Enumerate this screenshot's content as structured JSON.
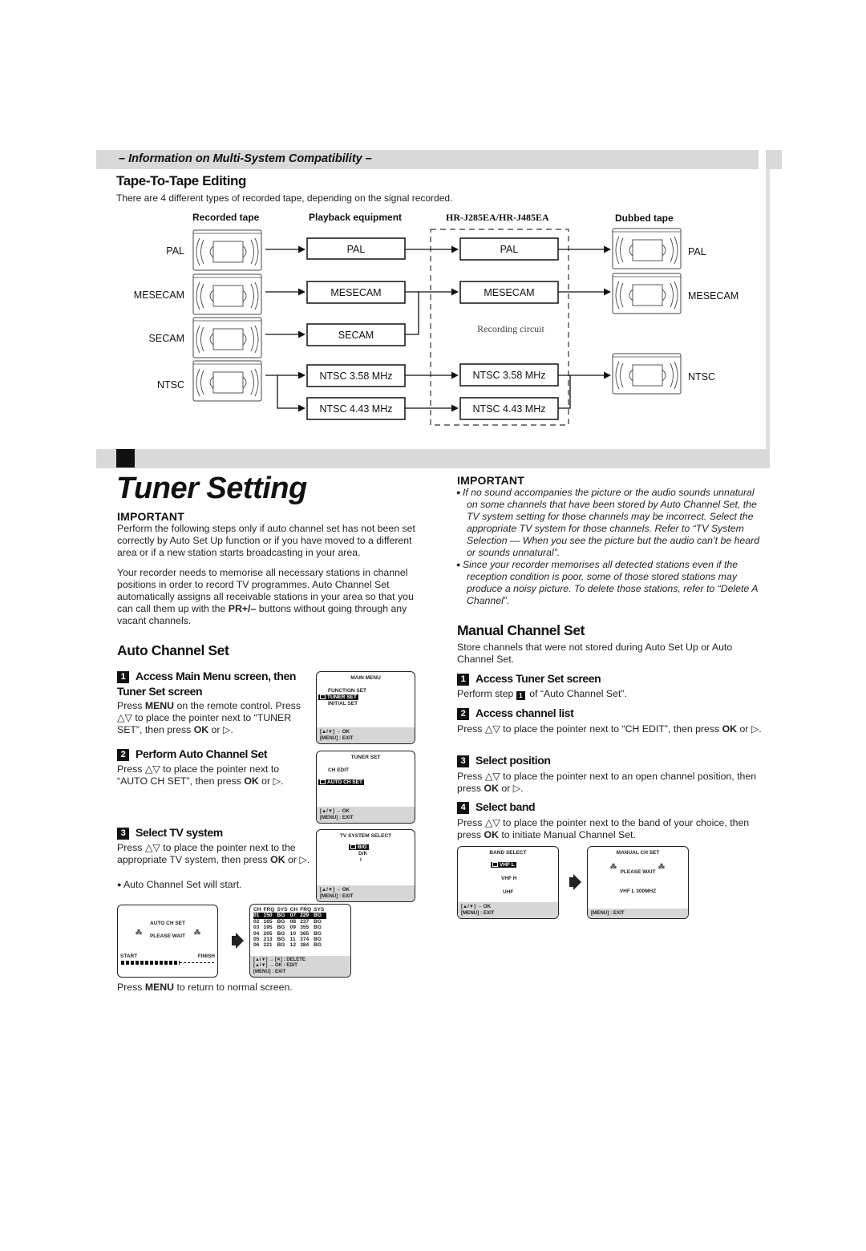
{
  "section_banner": "– Information on Multi-System Compatibility –",
  "tape_to_tape": {
    "heading": "Tape-To-Tape Editing",
    "intro": "There are 4 different types of recorded tape, depending on the signal recorded.",
    "columns": [
      "Recorded tape",
      "Playback equipment",
      "HR-J285EA/HR-J485EA",
      "Dubbed tape"
    ],
    "recorded_tapes": [
      "PAL",
      "MESECAM",
      "SECAM",
      "NTSC"
    ],
    "playback_boxes": [
      "PAL",
      "MESECAM",
      "SECAM",
      "NTSC 3.58 MHz",
      "NTSC 4.43 MHz"
    ],
    "recording_boxes": [
      "PAL",
      "MESECAM",
      "NTSC 3.58 MHz",
      "NTSC 4.43 MHz"
    ],
    "recording_circuit_label": "Recording circuit",
    "dubbed_tapes": [
      "PAL",
      "MESECAM",
      "NTSC"
    ]
  },
  "tuner": {
    "title": "Tuner Setting",
    "important_label": "IMPORTANT",
    "important_text": "Perform the following steps only if auto channel set has not been set correctly by Auto Set Up function or if you have moved to a different area or if a new station starts broadcasting in your area.",
    "intro_1": "Your recorder needs to memorise all necessary stations in channel positions in order to record TV programmes. Auto Channel Set automatically assigns all receivable stations in your area so that you can call them up with the ",
    "intro_bold": "PR+/–",
    "intro_2": " buttons without going through any vacant channels."
  },
  "auto_channel_set": {
    "heading": "Auto Channel Set",
    "steps": [
      {
        "num": "1",
        "title": "Access Main Menu screen, then Tuner Set screen",
        "text_a": "Press ",
        "bold_a": "MENU",
        "text_b": " on the remote control. Press △▽ to place the pointer next to “TUNER SET”, then press ",
        "bold_b": "OK",
        "text_c": " or ▷."
      },
      {
        "num": "2",
        "title": "Perform Auto Channel Set",
        "text_a": "Press △▽ to place the pointer next to “AUTO CH SET”, then press ",
        "bold_a": "OK",
        "text_b": " or ▷."
      },
      {
        "num": "3",
        "title": "Select TV system",
        "text_a": "Press △▽ to place the pointer next to the appropriate TV system, then press ",
        "bold_a": "OK",
        "text_b": " or ▷.",
        "bullet": "Auto Channel Set will start."
      }
    ],
    "footer_a": "Press ",
    "footer_bold": "MENU",
    "footer_b": " to return to normal screen."
  },
  "osd": {
    "main_menu": {
      "title": "MAIN MENU",
      "items": [
        "FUNCTION SET",
        "TUNER SET",
        "INITIAL SET"
      ],
      "selected": "TUNER SET",
      "foot1": "[▲/▼] → OK",
      "foot2": "[MENU] : EXIT"
    },
    "tuner_set": {
      "title": "TUNER SET",
      "items": [
        "CH EDIT",
        "AUTO CH SET"
      ],
      "selected": "AUTO CH SET",
      "foot1": "[▲/▼] → OK",
      "foot2": "[MENU] : EXIT"
    },
    "tv_system": {
      "title": "TV SYSTEM SELECT",
      "items": [
        "B/G",
        "D/K",
        "I"
      ],
      "selected": "B/G",
      "foot1": "[▲/▼] → OK",
      "foot2": "[MENU] : EXIT"
    },
    "auto_progress": {
      "title": "AUTO CH SET",
      "wait": "PLEASE WAIT",
      "start": "START",
      "finish": "FINISH",
      "progress": 0.63
    },
    "channel_list": {
      "headers": [
        "CH",
        "FRQ",
        "SYS",
        "CH",
        "FRQ",
        "SYS"
      ],
      "rows": [
        [
          "01",
          "150",
          "BG",
          "07",
          "229",
          "BG"
        ],
        [
          "02",
          "165",
          "BG",
          "08",
          "237",
          "BG"
        ],
        [
          "03",
          "195",
          "BG",
          "09",
          "355",
          "BG"
        ],
        [
          "04",
          "205",
          "BG",
          "10",
          "365",
          "BG"
        ],
        [
          "05",
          "213",
          "BG",
          "11",
          "374",
          "BG"
        ],
        [
          "06",
          "221",
          "BG",
          "12",
          "384",
          "BG"
        ]
      ],
      "foot1": "[▲/▼] → [✕] : DELETE",
      "foot2": "[▲/▼] → OK : EDIT",
      "foot3": "[MENU] : EXIT"
    },
    "band_select": {
      "title": "BAND SELECT",
      "items": [
        "VHF L",
        "VHF H",
        "UHF"
      ],
      "selected": "VHF L",
      "foot1": "[▲/▼] → OK",
      "foot2": "[MENU] : EXIT"
    },
    "manual_ch_set": {
      "title": "MANUAL CH SET",
      "wait": "PLEASE WAIT",
      "band": "VHF L  300MHZ",
      "foot": "[MENU] : EXIT"
    }
  },
  "right_important": {
    "label": "IMPORTANT",
    "bullets": [
      "If no sound accompanies the picture or the audio sounds unnatural on some channels that have been stored by Auto Channel Set, the TV system setting for those channels may be incorrect. Select the appropriate TV system for those channels. Refer to “TV System Selection — When you see the picture but the audio can’t be heard or sounds unnatural”.",
      "Since your recorder memorises all detected stations even if the reception condition is poor, some of those stored stations may produce a noisy picture. To delete those stations, refer to “Delete A Channel”."
    ]
  },
  "manual_channel_set": {
    "heading": "Manual Channel Set",
    "intro": "Store channels that were not stored during Auto Set Up or Auto Channel Set.",
    "steps": [
      {
        "num": "1",
        "title": "Access Tuner Set screen",
        "text_a": "Perform step ",
        "ref": "1",
        "text_b": " of “Auto Channel Set”."
      },
      {
        "num": "2",
        "title": "Access channel list",
        "text_a": "Press △▽ to place the pointer next to “CH EDIT”, then press ",
        "bold_a": "OK",
        "text_b": " or ▷."
      },
      {
        "num": "3",
        "title": "Select position",
        "text_a": "Press △▽ to place the pointer next to an open channel position, then press ",
        "bold_a": "OK",
        "text_b": " or ▷."
      },
      {
        "num": "4",
        "title": "Select band",
        "text_a": "Press △▽ to place the pointer next to the band of your choice, then press ",
        "bold_a": "OK",
        "text_b": " to initiate Manual Channel Set."
      }
    ]
  }
}
